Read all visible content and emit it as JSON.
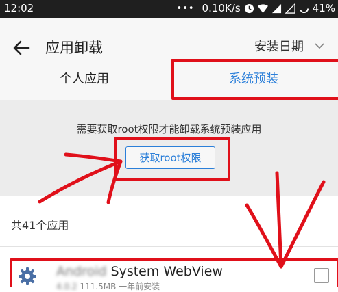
{
  "status_bar": {
    "time": "12:02",
    "dots": "•••",
    "speed": "0.10K/s",
    "battery": "41%"
  },
  "header": {
    "title": "应用卸载",
    "sort_label": "安装日期"
  },
  "tabs": [
    {
      "label": "个人应用"
    },
    {
      "label": "系统预装"
    }
  ],
  "notice": {
    "message": "需要获取root权限才能卸载系统预装应用",
    "button_label": "获取root权限"
  },
  "list": {
    "count_label": "共41个应用",
    "apps": [
      {
        "name_prefix": "Android",
        "name": "System WebView",
        "meta_prefix": "4.0.2",
        "size": "111.5MB",
        "installed": "一年前安装"
      }
    ]
  },
  "annotation_color": "#e0101a",
  "accent_color": "#2b7fd9"
}
